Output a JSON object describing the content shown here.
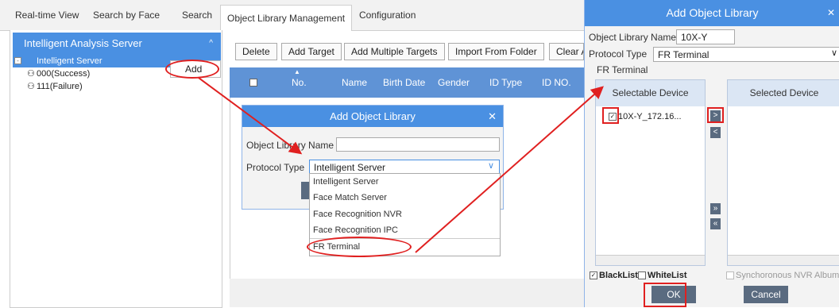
{
  "top_tabs": [
    "Real-time View",
    "Search by Face",
    "Search",
    "Object Library Management",
    "Configuration"
  ],
  "left_panel": {
    "title": "Intelligent Analysis Server",
    "server": "Intelligent Server",
    "add_label": "Add",
    "items": [
      "000(Success)",
      "111(Failure)"
    ]
  },
  "toolbar": [
    "Delete",
    "Add Target",
    "Add Multiple Targets",
    "Import From Folder",
    "Clear A"
  ],
  "grid_columns": [
    "No.",
    "Name",
    "Birth Date",
    "Gender",
    "ID Type",
    "ID NO."
  ],
  "dialog": {
    "title": "Add Object Library",
    "name_label": "Object Library Name",
    "protocol_label": "Protocol Type",
    "protocol_value": "Intelligent Server",
    "options": [
      "Intelligent Server",
      "Face Match Server",
      "Face Recognition NVR",
      "Face Recognition IPC",
      "FR Terminal"
    ]
  },
  "right_dialog": {
    "title": "Add Object Library",
    "name_label": "Object Library Name",
    "name_value": "10X-Y",
    "protocol_label": "Protocol Type",
    "protocol_value": "FR Terminal",
    "group_label": "FR Terminal",
    "selectable_header": "Selectable Device",
    "selected_header": "Selected Device",
    "device": "10X-Y_172.16...",
    "blacklist": "BlackList",
    "whitelist": "WhiteList",
    "sync": "Synchoronous NVR Album",
    "ok": "OK",
    "cancel": "Cancel"
  },
  "colors": {
    "accent": "#4a90e2",
    "annotation": "#e02020"
  }
}
